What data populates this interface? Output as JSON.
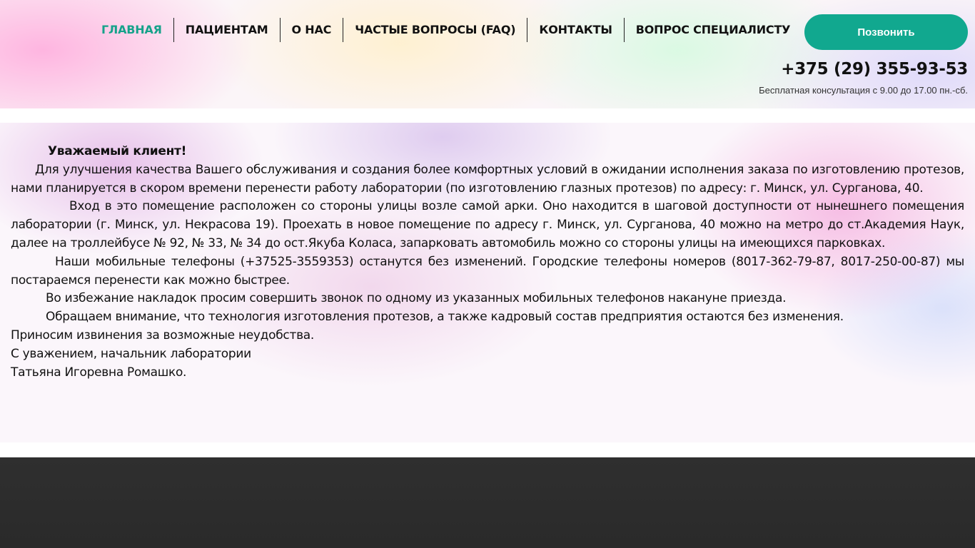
{
  "nav": {
    "items": [
      {
        "label": "ГЛАВНАЯ",
        "active": true
      },
      {
        "label": "ПАЦИЕНТАМ",
        "active": false
      },
      {
        "label": "О НАС",
        "active": false
      },
      {
        "label": "ЧАСТЫЕ ВОПРОСЫ (FAQ)",
        "active": false
      },
      {
        "label": "КОНТАКТЫ",
        "active": false
      },
      {
        "label": "ВОПРОС СПЕЦИАЛИСТУ",
        "active": false
      }
    ],
    "accent_color": "#16a28a"
  },
  "header": {
    "call_button_label": "Позвонить",
    "call_button_color": "#11a88f",
    "phone": "+375 (29) 355-93-53",
    "consultation": "Бесплатная консультация с 9.00 до 17.00 пн.-сб."
  },
  "notice": {
    "greeting": "Уважаемый клиент!",
    "paragraph1": "Для улучшения качества Вашего обслуживания и создания более комфортных условий в ожидании исполнения заказа по изготовлению протезов, нами планируется в скором времени перенести работу лаборатории (по изготовлению глазных протезов) по адресу: г. Минск, ул. Сурганова, 40.",
    "paragraph2": "Вход в это помещение расположен со стороны улицы возле самой арки. Оно находится в шаговой доступности от нынешнего помещения лаборатории (г. Минск, ул. Некрасова 19). Проехать в новое помещение по адресу г. Минск, ул. Сурганова, 40 можно на метро до ст.Академия Наук, далее на троллейбусе № 92, № 33, № 34 до ост.Якуба Коласа, запарковать автомобиль можно со стороны улицы на имеющихся парковках.",
    "paragraph3": "Наши мобильные телефоны (+37525-3559353) останутся без изменений. Городские телефоны номеров (8017-362-79-87, 8017-250-00-87) мы постараемся перенести как можно быстрее.",
    "paragraph4": "Во избежание накладок просим совершить звонок по одному из указанных мобильных телефонов накануне приезда.",
    "paragraph5": "Обращаем внимание, что технология изготовления протезов, а также кадровый состав предприятия остаются без изменения.",
    "apology": "Приносим извинения  за возможные неудобства.",
    "signoff": "С уважением, начальник лаборатории",
    "signature": "Татьяна Игоревна Ромашко."
  }
}
